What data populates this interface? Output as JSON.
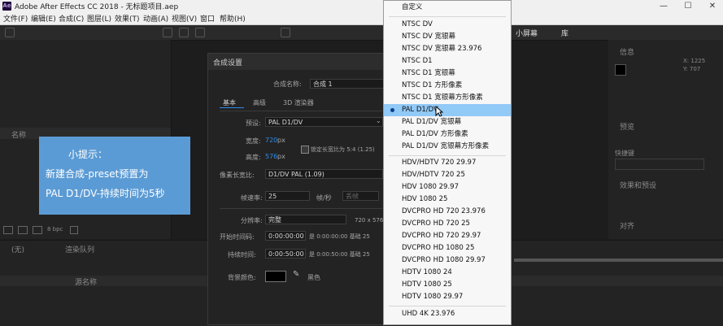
{
  "window": {
    "title": "Adobe After Effects CC 2018 - 无标题项目.aep",
    "logo": "Ae"
  },
  "menu": [
    "文件(F)",
    "编辑(E)",
    "合成(C)",
    "图层(L)",
    "效果(T)",
    "动画(A)",
    "视图(V)",
    "窗口",
    "帮助(H)"
  ],
  "left_panel": {
    "col_name": "名称",
    "bpc": "8 bpc"
  },
  "tip": {
    "line1": "小提示：",
    "line2": "新建合成-preset预置为",
    "line3": "PAL D1/DV-持续时间为5秒"
  },
  "dialog": {
    "title": "合成设置",
    "comp_name_label": "合成名称:",
    "comp_name": "合成 1",
    "tabs": [
      "基本",
      "高级",
      "3D 渲染器"
    ],
    "preset_label": "预设:",
    "preset": "PAL D1/DV",
    "width_label": "宽度:",
    "width": "720",
    "height_label": "高度:",
    "height": "576",
    "px": "px",
    "lock_label": "锁定长宽比为 5:4 (1.25)",
    "par_label": "像素长宽比:",
    "par": "D1/DV PAL (1.09)",
    "fps_label": "帧速率:",
    "fps": "25",
    "fps_unit": "帧/秒",
    "drop": "丢帧",
    "res_label": "分辨率:",
    "res": "完整",
    "res_info": "720 x 576，",
    "start_label": "开始时间码:",
    "start": "0:00:00:00",
    "start_info": "是 0:00:00:00  基础 25",
    "dur_label": "持续时间:",
    "dur": "0:00:50:00",
    "dur_info": "是 0:00:50:00  基础 25",
    "bg_label": "背景颜色:",
    "bg_name": "黑色"
  },
  "dropdown": {
    "options": [
      "自定义",
      "NTSC DV",
      "NTSC DV 宽银幕",
      "NTSC DV 宽银幕 23.976",
      "NTSC D1",
      "NTSC D1 宽银幕",
      "NTSC D1 方形像素",
      "NTSC D1 宽银幕方形像素",
      "PAL D1/DV",
      "PAL D1/DV 宽银幕",
      "PAL D1/DV 方形像素",
      "PAL D1/DV 宽银幕方形像素",
      "HDV/HDTV 720 29.97",
      "HDV/HDTV 720 25",
      "HDV 1080 29.97",
      "HDV 1080 25",
      "DVCPRO HD 720 23.976",
      "DVCPRO HD 720 25",
      "DVCPRO HD 720 29.97",
      "DVCPRO HD 1080 25",
      "DVCPRO HD 1080 29.97",
      "HDTV 1080 24",
      "HDTV 1080 25",
      "HDTV 1080 29.97",
      "UHD 4K 23.976"
    ],
    "selected_index": 8
  },
  "right_panel": {
    "tab1": "小屏幕",
    "tab2": "库",
    "info": "信息",
    "preview": "预览",
    "shortcut": "快捷键",
    "effects": "效果和预设",
    "align": "对齐",
    "coords1": "X: 1225",
    "coords2": "Y: 707"
  },
  "timeline": {
    "tab1": "(无)",
    "tab2": "渲染队列",
    "source_name": "源名称"
  }
}
